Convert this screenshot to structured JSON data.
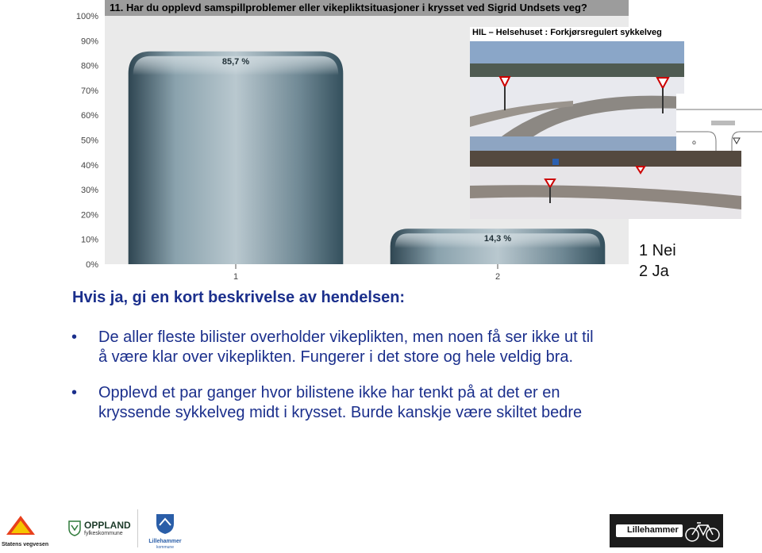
{
  "chart_data": {
    "type": "bar",
    "title": "11. Har du opplevd samspillproblemer eller vikepliktsituasjoner i krysset ved Sigrid Undsets veg?",
    "categories": [
      "1",
      "2"
    ],
    "values": [
      85.7,
      14.3
    ],
    "value_labels": [
      "85,7 %",
      "14,3 %"
    ],
    "yticks": [
      "0%",
      "10%",
      "20%",
      "30%",
      "40%",
      "50%",
      "60%",
      "70%",
      "80%",
      "90%",
      "100%"
    ],
    "ylim": [
      0,
      100
    ],
    "grid": false,
    "colors": {
      "plot_bg": "#eaeaea",
      "title_bg": "#9c9c9c",
      "bar_dark": "#3e5560",
      "bar_light": "#b9c8cf"
    }
  },
  "photo_label": "HIL – Helsehuset : Forkjørsregulert sykkelveg",
  "legend": [
    "1 Nei",
    "2 Ja"
  ],
  "subheading": "Hvis ja, gi en kort beskrivelse av hendelsen:",
  "bullets": [
    {
      "symbol": "•",
      "lines": [
        "De aller fleste bilister overholder vikeplikten, men noen få ser ikke ut til",
        "å være klar over vikeplikten. Fungerer i det store og hele veldig bra."
      ]
    },
    {
      "symbol": "•",
      "lines": [
        "Opplevd et par ganger hvor bilistene ikke har tenkt på at det er en",
        "kryssende sykkelveg midt i krysset. Burde kanskje være skiltet bedre"
      ]
    }
  ],
  "footer": {
    "svv": "Statens vegvesen",
    "oppland_name": "OPPLAND",
    "oppland_sub": "fylkeskommune",
    "lillehammer_name": "Lillehammer",
    "lillehammer_sub": "kommune",
    "lillehammer_brand": "Lillehammer"
  }
}
